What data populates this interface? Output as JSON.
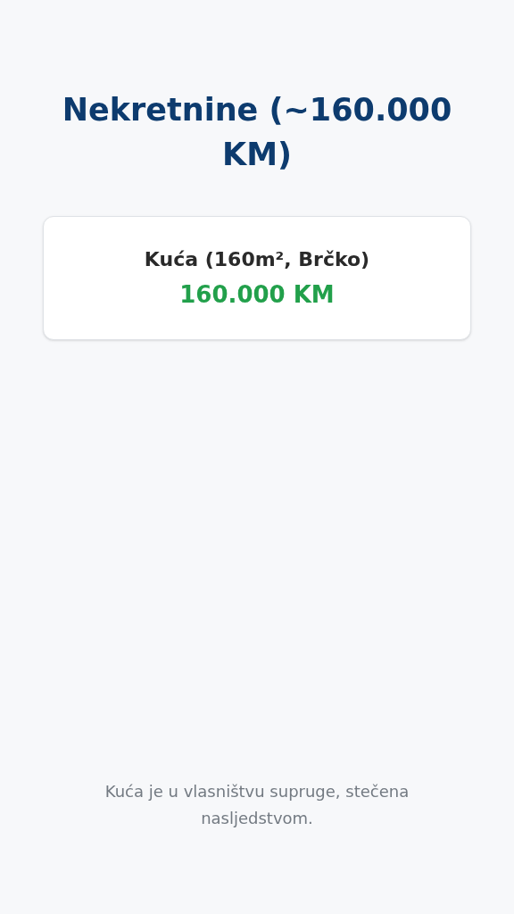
{
  "title": "Nekretnine (~160.000 KM)",
  "card": {
    "label": "Kuća (160m², Brčko)",
    "value": "160.000 KM"
  },
  "footnote": "Kuća je u vlasništvu supruge, stečena nasljedstvom."
}
